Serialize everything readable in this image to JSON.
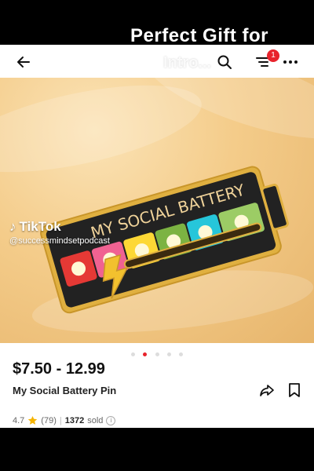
{
  "video_overlay": {
    "title": "Perfect Gift for",
    "subtitle": "Intro..."
  },
  "topbar": {
    "back_icon": "arrow-left-icon",
    "search_icon": "search-icon",
    "menu_icon": "menu-icon",
    "more_icon": "more-horizontal-icon",
    "cart_badge": "1"
  },
  "product_image": {
    "pin_text": "MY SOCIAL BATTERY",
    "slot_colors": [
      "#e53935",
      "#f06292",
      "#fdd835",
      "#7cb342",
      "#26c6da",
      "#9ccc65"
    ],
    "carousel_count": 5,
    "carousel_active_index": 1
  },
  "watermark": {
    "brand": "TikTok",
    "handle": "@successmindsetpodcast"
  },
  "product": {
    "price": "$7.50 - 12.99",
    "name": "My Social Battery Pin",
    "rating": "4.7",
    "review_count": "(79)",
    "separator": "|",
    "sold_number": "1372",
    "sold_label": "sold"
  },
  "colors": {
    "accent": "#e8232c",
    "star": "#f5b400"
  }
}
